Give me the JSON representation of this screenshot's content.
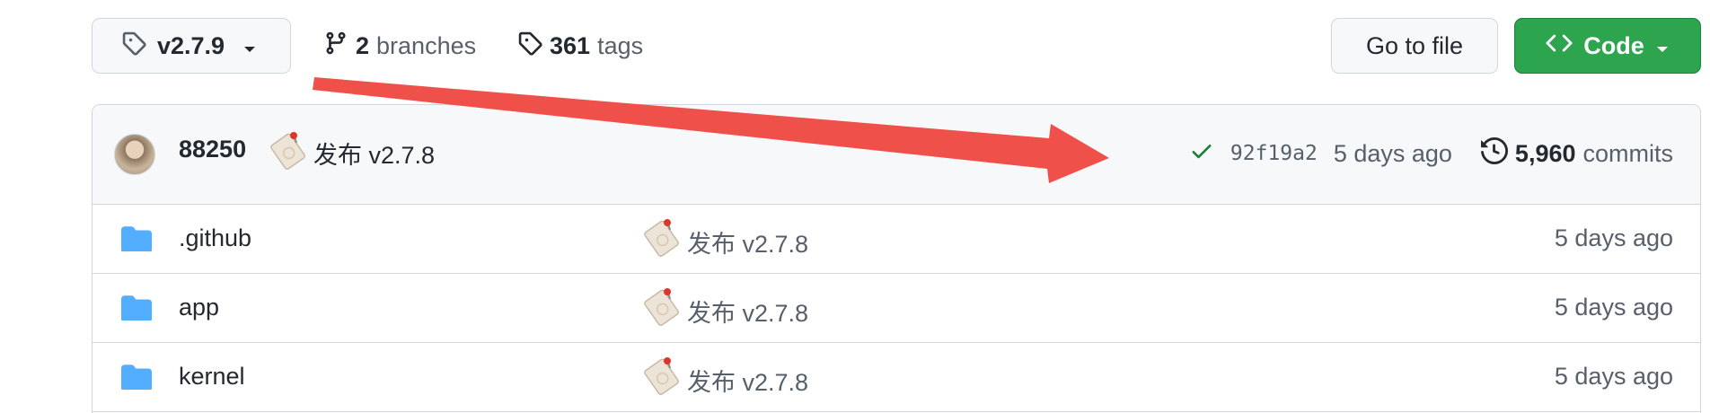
{
  "toolbar": {
    "tag_label": "v2.7.9",
    "branches_count": "2",
    "branches_word": "branches",
    "tags_count": "361",
    "tags_word": "tags",
    "goto_label": "Go to file",
    "code_label": "Code"
  },
  "commit": {
    "author": "88250",
    "message": "发布 v2.7.8",
    "sha": "92f19a2",
    "age": "5 days ago",
    "commits_count": "5,960",
    "commits_word": "commits",
    "status": "success"
  },
  "files": [
    {
      "name": ".github",
      "message": "发布 v2.7.8",
      "age": "5 days ago",
      "type": "folder"
    },
    {
      "name": "app",
      "message": "发布 v2.7.8",
      "age": "5 days ago",
      "type": "folder"
    },
    {
      "name": "kernel",
      "message": "发布 v2.7.8",
      "age": "5 days ago",
      "type": "folder"
    }
  ],
  "icons": {
    "tag": "tag-icon",
    "branch": "git-branch-icon",
    "caret": "caret-down-icon",
    "code": "code-icon",
    "check": "check-icon",
    "history": "history-icon",
    "folder": "folder-icon",
    "commit_emoji": "bookmark-tag-emoji-icon"
  },
  "colors": {
    "primary_button": "#2da44e",
    "success_check": "#1a7f37",
    "folder": "#54aeff",
    "annotation_arrow": "#f0504a"
  }
}
